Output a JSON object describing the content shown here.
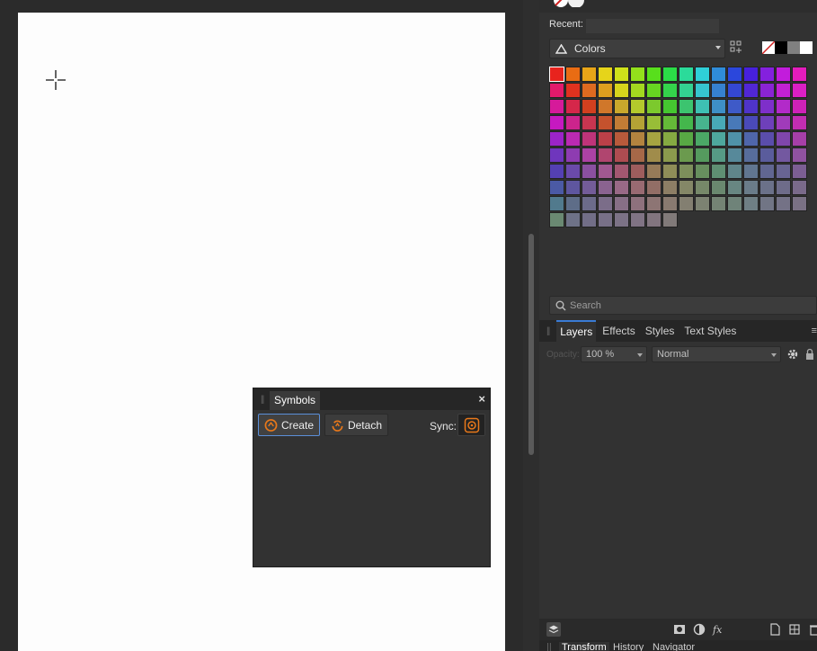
{
  "colors_panel": {
    "recent_label": "Recent:",
    "palette_name": "Colors",
    "quick_swatches": [
      "none",
      "#000000",
      "#808080",
      "#ffffff"
    ],
    "swatch_rows": [
      [
        "#e8231d",
        "#e96c13",
        "#e8a518",
        "#e6d41a",
        "#cfe21a",
        "#93e01b",
        "#58df1c",
        "#2bdd47",
        "#2bdb9a",
        "#2fcfd7",
        "#2f8cd9",
        "#2b47dc",
        "#4720dd",
        "#8420de",
        "#c21cdc",
        "#e41cbc"
      ],
      [
        "#e31a6b",
        "#e0321f",
        "#de6a20",
        "#dc9f1f",
        "#d6d51c",
        "#a3d81f",
        "#67d521",
        "#34d34b",
        "#33d192",
        "#36c4cf",
        "#3681cf",
        "#3447d2",
        "#5127d4",
        "#8a24d4",
        "#c221d2",
        "#db1fc4"
      ],
      [
        "#d61a9a",
        "#d5274a",
        "#d2401f",
        "#d0772a",
        "#c9a82c",
        "#b4c92c",
        "#7cc92d",
        "#45c730",
        "#3cc46f",
        "#3ec0b3",
        "#3e8fc6",
        "#3e5ac8",
        "#4f34c9",
        "#7e2fca",
        "#b22ac9",
        "#ce22b7"
      ],
      [
        "#c619c0",
        "#cc248c",
        "#c83550",
        "#c5522d",
        "#c27c35",
        "#b4a235",
        "#98bd37",
        "#64ba38",
        "#44b74c",
        "#47b48e",
        "#48a9b6",
        "#4879b8",
        "#4a4ab9",
        "#6e40ba",
        "#a03bba",
        "#c22db1"
      ],
      [
        "#9b24c8",
        "#ba2ab2",
        "#be3479",
        "#bb4048",
        "#b85a3b",
        "#b3833f",
        "#a6a441",
        "#85aa42",
        "#58a844",
        "#4ba866",
        "#4ea79d",
        "#4f92a8",
        "#4f66aa",
        "#5a4dab",
        "#7f46ab",
        "#a63fa8"
      ],
      [
        "#6f36bd",
        "#8e3cb1",
        "#ac42a4",
        "#b0456f",
        "#ae4c51",
        "#a66848",
        "#a08c4b",
        "#8b9a4d",
        "#6b9a4e",
        "#559a5e",
        "#569a85",
        "#57899a",
        "#576d9b",
        "#5a5c9c",
        "#7358a0",
        "#9052a0"
      ],
      [
        "#5440b2",
        "#6a4aaa",
        "#8b50a0",
        "#a05891",
        "#a25770",
        "#9e5d5d",
        "#967a58",
        "#8f8d58",
        "#7d8f5b",
        "#678f5e",
        "#5f8f73",
        "#60858a",
        "#617690",
        "#616691",
        "#686492",
        "#7c5e93"
      ],
      [
        "#4b5aa5",
        "#5e569f",
        "#735c98",
        "#8a6390",
        "#986986",
        "#986a72",
        "#926e66",
        "#8d7e65",
        "#848767",
        "#768869",
        "#6a886f",
        "#688682",
        "#6a7c89",
        "#6b7189",
        "#6e6c89",
        "#7a6a8a"
      ],
      [
        "#517a8d",
        "#5e6d88",
        "#6c6b8a",
        "#7b6d89",
        "#876f86",
        "#8e717d",
        "#8d7574",
        "#897a70",
        "#837f71",
        "#7c8272",
        "#748374",
        "#6f8379",
        "#6f7f84",
        "#717585",
        "#747286",
        "#7a7184"
      ],
      [
        "#6a8972",
        "#6e7287",
        "#726e87",
        "#787087",
        "#7c7286",
        "#807384",
        "#82757f",
        "#817a79"
      ]
    ],
    "search_placeholder": "Search"
  },
  "layers_panel": {
    "tabs": [
      "Layers",
      "Effects",
      "Styles",
      "Text Styles"
    ],
    "opacity_label": "Opacity:",
    "opacity_value": "100 %",
    "blend_mode": "Normal"
  },
  "bottom_tabs": [
    "Transform",
    "History",
    "Navigator"
  ],
  "symbols_panel": {
    "title": "Symbols",
    "create_label": "Create",
    "detach_label": "Detach",
    "sync_label": "Sync:",
    "close_glyph": "×"
  },
  "accent_color": "#e8781a"
}
